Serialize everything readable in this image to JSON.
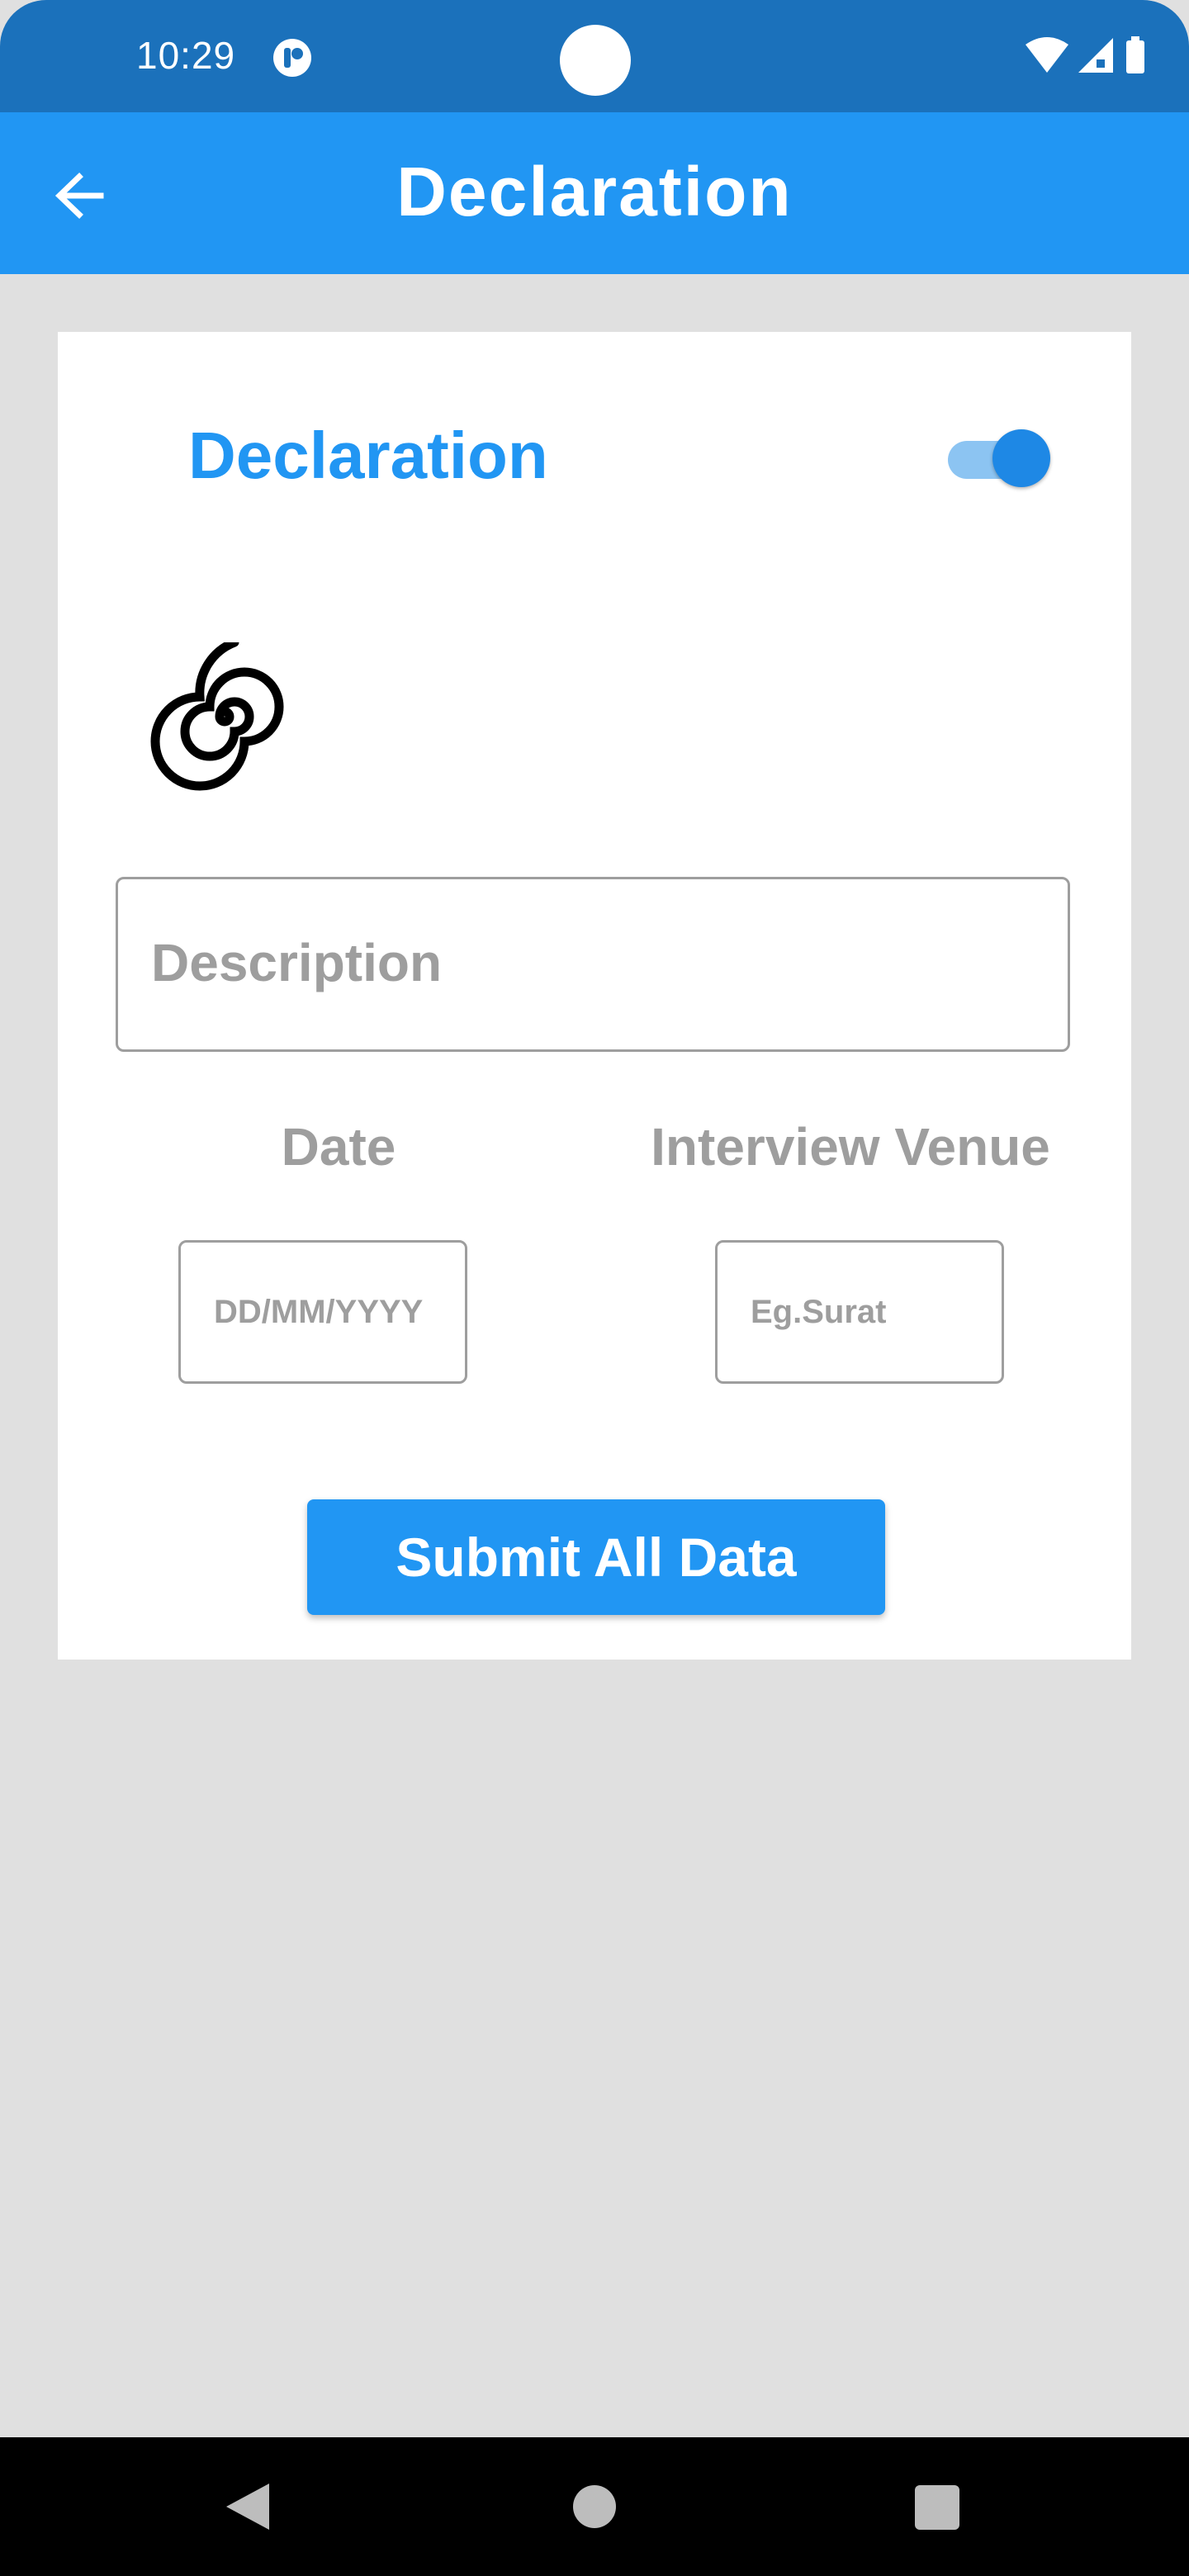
{
  "status_bar": {
    "time": "10:29",
    "icons": [
      "app-notification-icon",
      "wifi-icon",
      "cellular-signal-icon",
      "battery-icon"
    ]
  },
  "app_bar": {
    "title": "Declaration",
    "back_icon": "arrow-back-icon"
  },
  "card": {
    "title": "Declaration",
    "toggle_on": true,
    "image_icon": "spiral-icon",
    "description": {
      "placeholder": "Description",
      "value": ""
    },
    "date": {
      "label": "Date",
      "placeholder": "DD/MM/YYYY",
      "value": ""
    },
    "venue": {
      "label": "Interview Venue",
      "placeholder": "Eg.Surat",
      "value": ""
    },
    "submit_label": "Submit All Data"
  },
  "nav_bar": {
    "icons": [
      "nav-back-icon",
      "nav-home-icon",
      "nav-recents-icon"
    ]
  },
  "colors": {
    "primary": "#2196f3",
    "status_bar": "#1b71bb",
    "background": "#e0e0e0",
    "placeholder": "#9e9e9e"
  }
}
